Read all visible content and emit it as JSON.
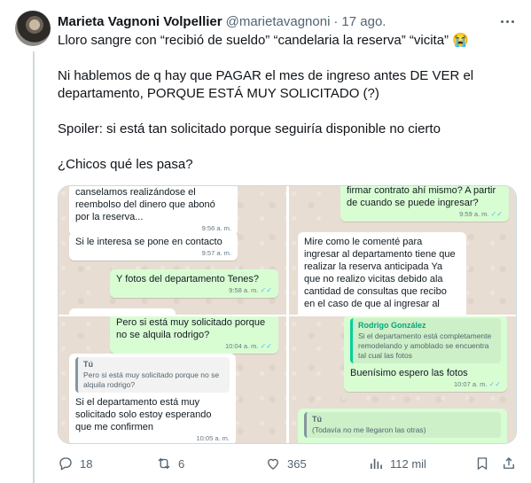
{
  "tweet": {
    "author_name": "Marieta Vagnoni Volpellier",
    "handle": "@marietavagnoni",
    "separator": "·",
    "date": "17 ago.",
    "lines": [
      "Lloro sangre con “recibió de sueldo” “candelaria la reserva”  “vicita” 😭",
      "",
      "Ni hablemos de q hay que PAGAR el mes de ingreso antes DE VER el",
      "departamento, PORQUE ESTÁ MUY SOLICITADO (?)",
      "",
      "Spoiler: si está tan solicitado porque seguiría disponible no cierto",
      "",
      "¿Chicos qué les pasa?"
    ]
  },
  "media": {
    "panel1": {
      "b1_text": "canselamos realizándose el reembolso del dinero que abonó por la reserva...",
      "b1_time": "9:56 a. m.",
      "b2_text": "Si le interesa se pone en contacto",
      "b2_time": "9:57 a. m.",
      "b3_text": "Y fotos del departamento Tenes?",
      "b3_time": "9:58 a. m."
    },
    "panel2": {
      "b1_text": "firmar contrato ahí mismo? A partir de cuando se puede ingresar?",
      "b1_time": "9:59 a. m.",
      "b2_text": "Mire como le comenté para ingresar al departamento tiene que realizar la reserva anticipada Ya que no realizo vicitas debido ala cantidad de consultas que recibo en el caso de que al ingresar al"
    },
    "panel3": {
      "b1_text": "Pero si está muy solicitado porque no se alquila rodrigo?",
      "b1_time": "10:04 a. m.",
      "quote_name": "Tú",
      "quote_text": "Pero si está muy solicitado porque no se alquila rodrigo?",
      "b2_text": "Si el departamento está muy solicitado solo estoy esperando que me confirmen",
      "b2_time": "10:05 a. m."
    },
    "panel4": {
      "quote_name": "Rodrigo González",
      "quote_text": "Si el departamento está completamente remodelando y amoblado se encuentra tal cual las fotos",
      "b1_text": "Buenísimo espero las fotos",
      "b1_time": "10:07 a. m.",
      "quote2_name": "Tú",
      "quote2_text": "(Todavía no me llegaron las otras)"
    }
  },
  "actions": {
    "replies": "18",
    "retweets": "6",
    "likes": "365",
    "views": "112 mil"
  },
  "colors": {
    "text": "#0f1419",
    "secondary": "#536471",
    "chat_bg": "#e7ddd3",
    "outgoing_bubble": "#d9fdd3",
    "read_ticks": "#53bdeb"
  }
}
